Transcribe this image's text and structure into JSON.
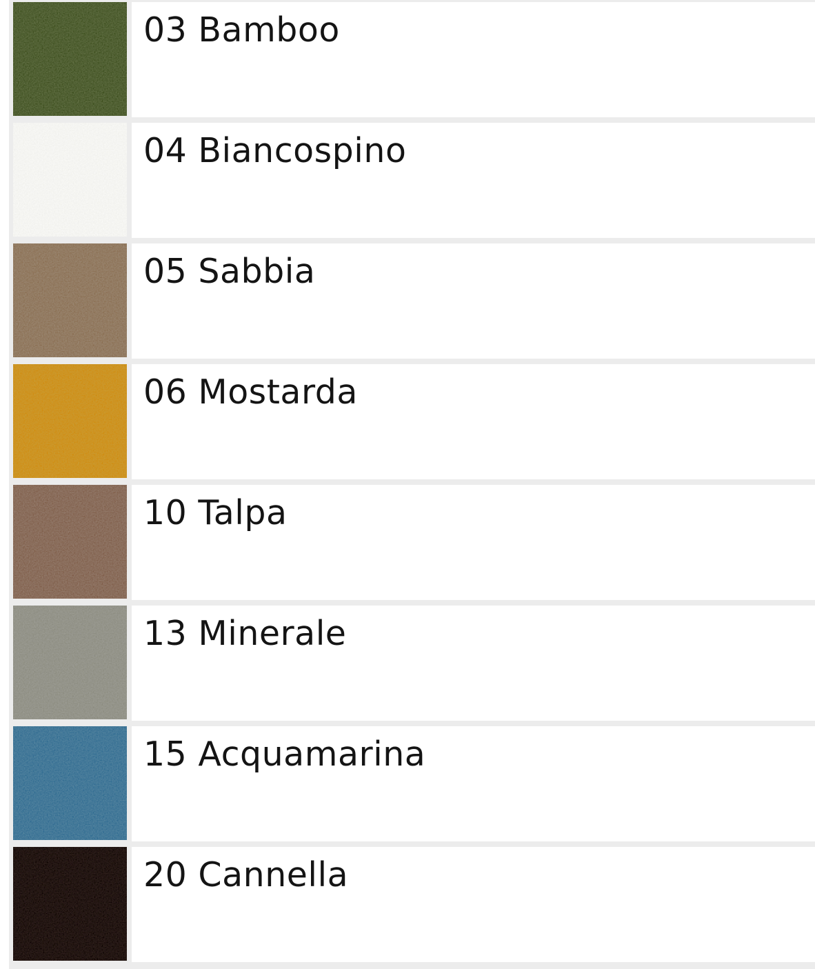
{
  "colors": [
    {
      "label": "03 Bamboo",
      "swatch": "#6c7a4d"
    },
    {
      "label": "04 Biancospino",
      "swatch": "#ecece8"
    },
    {
      "label": "05 Sabbia",
      "swatch": "#a1907c"
    },
    {
      "label": "06 Mostarda",
      "swatch": "#c7a23a"
    },
    {
      "label": "10 Talpa",
      "swatch": "#9b8576"
    },
    {
      "label": "13 Minerale",
      "swatch": "#a2a29b"
    },
    {
      "label": "15 Acquamarina",
      "swatch": "#5f8ea5"
    },
    {
      "label": "20 Cannella",
      "swatch": "#3a2823"
    }
  ]
}
